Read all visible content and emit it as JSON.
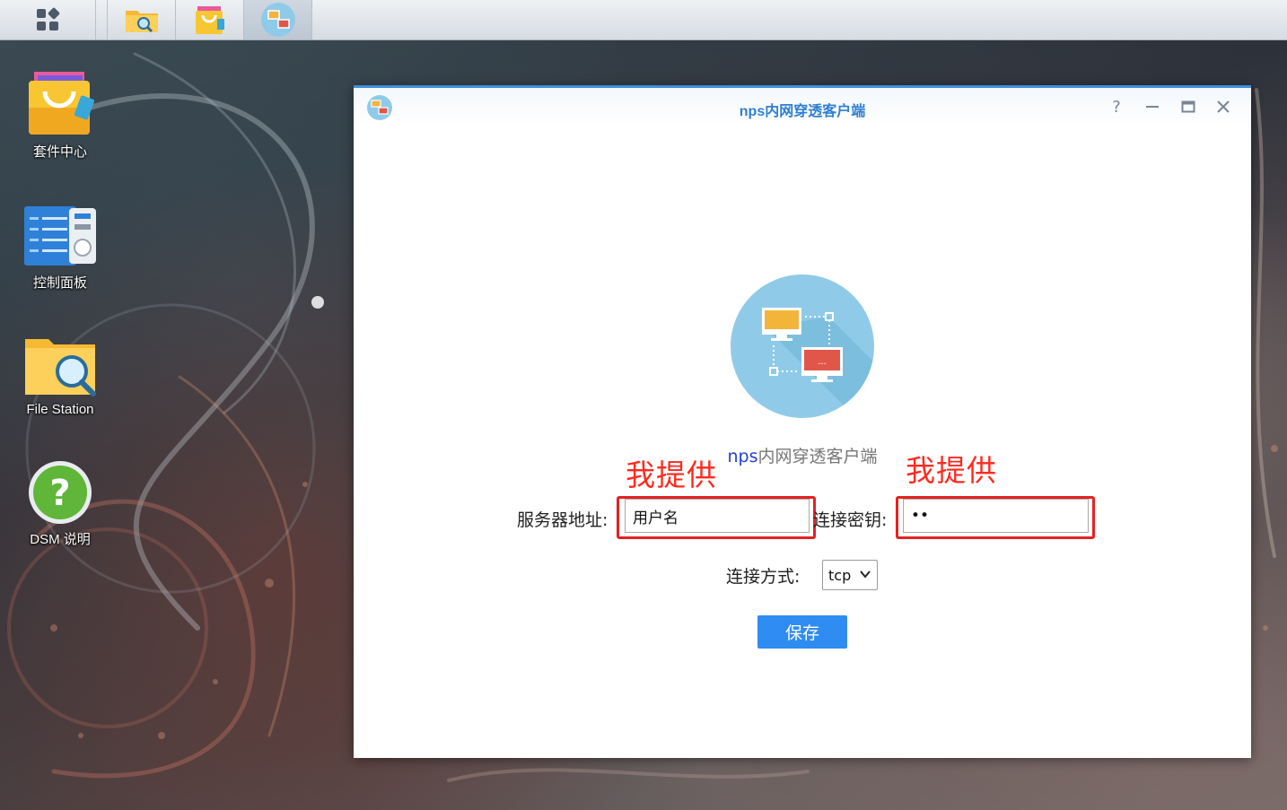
{
  "desktop": {
    "icons": [
      {
        "label": "套件中心",
        "icon": "package-center-icon"
      },
      {
        "label": "控制面板",
        "icon": "control-panel-icon"
      },
      {
        "label": "File Station",
        "icon": "file-station-icon"
      },
      {
        "label": "DSM 说明",
        "icon": "help-icon"
      }
    ]
  },
  "taskbar": {
    "items": [
      {
        "icon": "main-menu-icon"
      },
      {
        "icon": "file-station-icon"
      },
      {
        "icon": "package-center-icon"
      },
      {
        "icon": "nps-client-icon",
        "active": true
      }
    ]
  },
  "window": {
    "title": "nps内网穿透客户端",
    "controls": [
      "help-icon",
      "minimize-icon",
      "maximize-icon",
      "close-icon"
    ],
    "app_name_prefix": "nps",
    "app_name_suffix": "内网穿透客户端",
    "annotations": {
      "left": "我提供",
      "right": "我提供"
    },
    "server_label": "服务器地址:",
    "server_value": "用户名",
    "key_label": "连接密钥:",
    "key_value": "••",
    "mode_label": "连接方式:",
    "mode_value": "tcp",
    "save_label": "保存"
  },
  "colors": {
    "accent": "#2f8cf0",
    "title": "#2e7fd1",
    "annotation": "#ff2a1f"
  }
}
